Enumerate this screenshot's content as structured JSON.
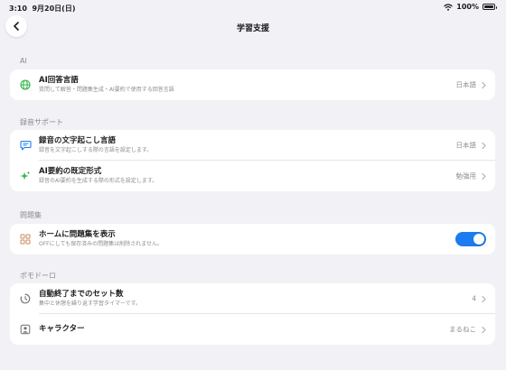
{
  "status_bar": {
    "time": "3:10",
    "date": "9月20日(日)",
    "battery": "100%"
  },
  "nav": {
    "title": "学習支援"
  },
  "colors": {
    "accent": "#1a7cf0",
    "green": "#2fb347",
    "orange": "#cf8a5c",
    "gray_icon": "#6c6c70"
  },
  "sections": [
    {
      "header": "AI",
      "rows": [
        {
          "title": "AI回答言語",
          "subtitle": "質問して解答・問題集生成・AI要約で使用する回答言語",
          "value": "日本語",
          "icon": "globe-icon"
        }
      ]
    },
    {
      "header": "録音サポート",
      "rows": [
        {
          "title": "録音の文字起こし言語",
          "subtitle": "録音を文字起こしする際の言語を設定します。",
          "value": "日本語",
          "icon": "speech-bubble-icon"
        },
        {
          "title": "AI要約の既定形式",
          "subtitle": "録音のAI要約を生成する際の形式を設定します。",
          "value": "勉強用",
          "icon": "sparkle-icon"
        }
      ]
    },
    {
      "header": "問題集",
      "rows": [
        {
          "title": "ホームに問題集を表示",
          "subtitle": "OFFにしても保存済みの問題集は削除されません。",
          "toggle_on": true,
          "icon": "grid-icon"
        }
      ]
    },
    {
      "header": "ポモドーロ",
      "rows": [
        {
          "title": "自動終了までのセット数",
          "subtitle": "集中と休憩を繰り返す学習タイマーです。",
          "value": "4",
          "icon": "timer-icon"
        },
        {
          "title": "キャラクター",
          "subtitle": "",
          "value": "まるねこ",
          "icon": "person-icon"
        }
      ]
    }
  ]
}
